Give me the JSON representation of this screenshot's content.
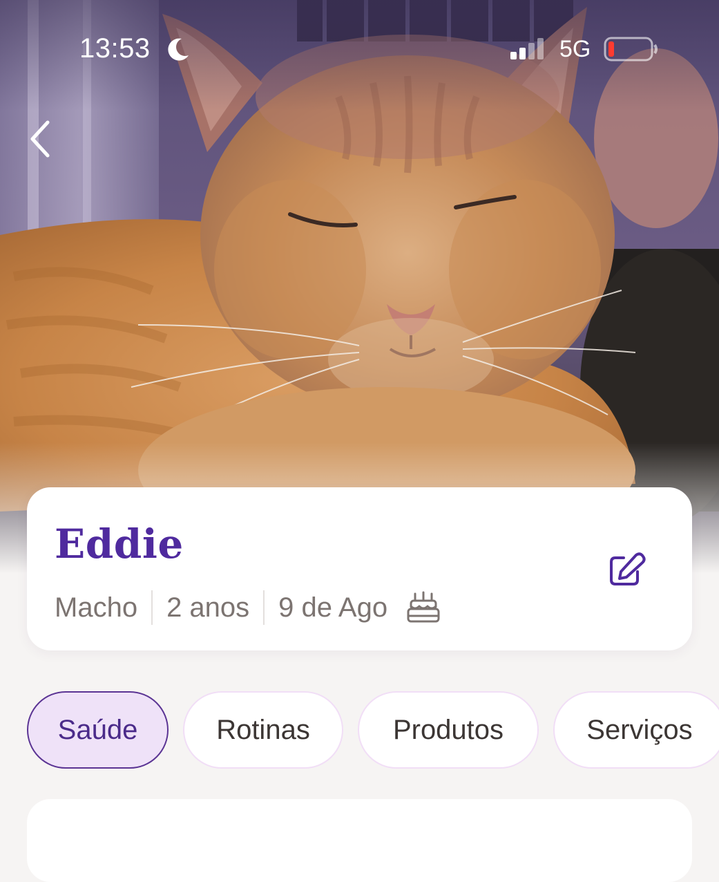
{
  "status_bar": {
    "time": "13:53",
    "network": "5G",
    "moon_icon": "moon-icon",
    "signal_icon": "cellular-signal-icon",
    "battery_icon": "battery-low-icon",
    "battery_color": "#ff3b30"
  },
  "header": {
    "back_icon": "chevron-left-icon",
    "photo": "pet-photo"
  },
  "pet": {
    "name": "Eddie",
    "sex": "Macho",
    "age": "2 anos",
    "birthday": "9 de Ago",
    "birthday_icon": "birthday-cake-icon",
    "edit_icon": "edit-icon"
  },
  "tabs": [
    {
      "label": "Saúde",
      "active": true
    },
    {
      "label": "Rotinas",
      "active": false
    },
    {
      "label": "Produtos",
      "active": false
    },
    {
      "label": "Serviços",
      "active": false
    }
  ],
  "colors": {
    "accent": "#4f2a9e",
    "active_tab_bg": "#efe2f8",
    "page_bg": "#f6f4f3",
    "muted_text": "#7c7471"
  }
}
